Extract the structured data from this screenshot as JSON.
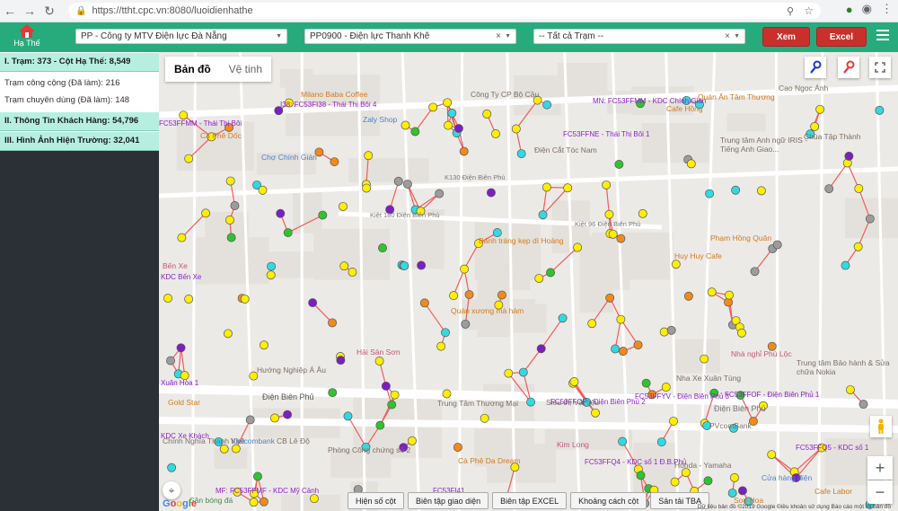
{
  "browser": {
    "url": "https://ttht.cpc.vn:8080/luoidienhathe"
  },
  "header": {
    "home_label": "Hạ Thế",
    "company_select": "PP - Công ty MTV Điện lực Đà Nẵng",
    "branch_select": "PP0900 - Điện lực Thanh Khê",
    "station_select": "-- Tất cả Trạm --",
    "view_button": "Xem",
    "excel_button": "Excel",
    "colors": {
      "bar": "#27ab7d",
      "button": "#c9302c"
    }
  },
  "sidebar": {
    "section1_title": "I. Trạm: 373 - Cột Hạ Thế: 8,549",
    "section1_items": [
      "Trạm công cộng (Đã làm): 216",
      "Trạm chuyên dùng (Đã làm): 148"
    ],
    "section2_title": "II. Thông Tin Khách Hàng: 54,796",
    "section3_title": "III. Hình Ảnh Hiện Trường: 32,041"
  },
  "map": {
    "tabs": [
      "Bản đồ",
      "Vệ tinh"
    ],
    "places": [
      "Milano Baba Coffee",
      "Công Ty CP Bộ Cầu",
      "Zaly Shop",
      "Chợ Chính Gián",
      "Cà Phê Dốc",
      "Điện Cắt Tóc Nam",
      "Bánh tráng kẹp dì Hoàng",
      "Quán xương mà hàm",
      "Hải Sản Sơn",
      "Hướng Nghiệp Á Âu",
      "Trung Tâm Thương Mại",
      "Quán Ăn Tâm Thương",
      "Cao Ngọc Ánh",
      "Cafe Hồng",
      "Trung tâm Anh ngữ IRIS - Tiếng Anh Giao...",
      "Chùa Tập Thành",
      "Phạm Hồng Quân",
      "Huy Huy Cafe",
      "Nhà nghỉ Phú Lộc",
      "Nha Xe Xuân Tùng",
      "Trung tâm Bảo hành & Sửa chữa Nokia",
      "Siêu thị Vật liệu",
      "Điện Biên Phủ",
      "PVcomBank",
      "Vietcombank",
      "CB Lê Độ",
      "Phòng Công chứng số 2",
      "Cà Phê Da Dream",
      "Kim Long",
      "Cửa hàng điện",
      "Honda - Yamaha",
      "Bến Xe",
      "Gold Star",
      "Sân bóng đá",
      "Chính Nghĩa Thanh Khê",
      "Son Hoa",
      "Cafe Labor"
    ],
    "roads": [
      "Điện Biên Phủ",
      "Kiệt 96 Điện Biên Phủ",
      "K130 Điện Biên Phủ",
      "Kiệt 180 Điện Biên Phủ",
      "Điện Biên Phủ"
    ],
    "station_labels": [
      "I38: FC53FI38 - Thái Thị Bôi 4",
      "MN: FC53FFMM - KDC Chính Gián",
      "FC53FFMM - Thái Thị Bôi",
      "FC53FFNE - Thái Thị Bôi 1",
      "KDC Bến Xe",
      "Xuân Hòa 1",
      "KDC Xe Khách",
      "FC53FFOP - Điện Biên Phủ 2",
      "FC53FFYV - Điện Biên Phủ 3",
      "FC53FFOF - Điện Biên Phủ 1",
      "FC53FFQ4 - KDC số 1 Đ.B.Phủ",
      "FC53FFQ5 - KDC số 1",
      "MF: FC53FFMF - KDC Mỹ Cảnh",
      "FC53FI41"
    ],
    "bottom_buttons": [
      "Hiện số cột",
      "Biên tập giao diện",
      "Biên tập EXCEL",
      "Khoảng cách cột",
      "Sản tải TBA"
    ],
    "google_logo": "Google",
    "attribution": "Dữ liệu bản đồ ©2019 Google   Điều khoản sử dụng   Báo cáo một lỗi bản đồ",
    "zoom_in": "+",
    "zoom_out": "−",
    "marker_colors": {
      "yellow": "#ffee00",
      "cyan": "#34d8e0",
      "green": "#2ec42e",
      "purple": "#7b1fc2",
      "gray": "#9c9c9c",
      "orange": "#f08a1c",
      "line": "#f45a5a"
    }
  }
}
